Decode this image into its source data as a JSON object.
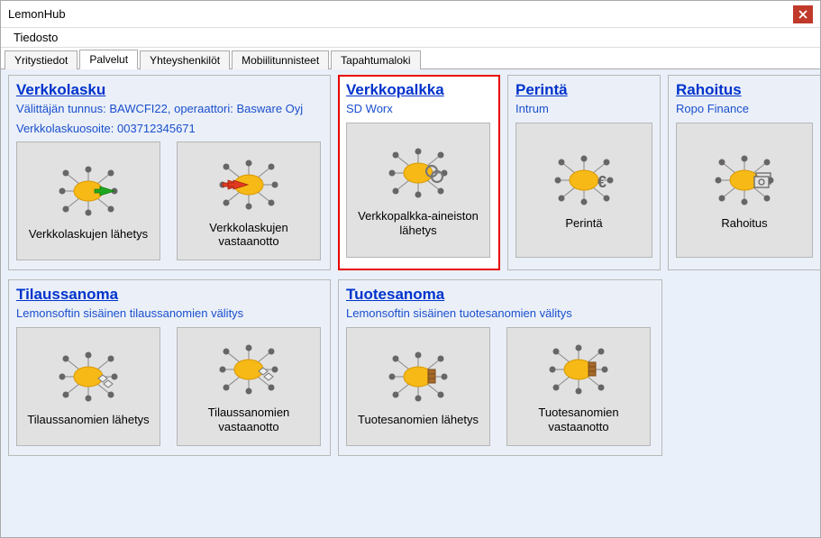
{
  "window": {
    "title": "LemonHub"
  },
  "menubar": {
    "file": "Tiedosto"
  },
  "tabs": [
    {
      "label": "Yritystiedot"
    },
    {
      "label": "Palvelut"
    },
    {
      "label": "Yhteyshenkilöt"
    },
    {
      "label": "Mobiilitunnisteet"
    },
    {
      "label": "Tapahtumaloki"
    }
  ],
  "activeTabIndex": 1,
  "panels": {
    "verkkolasku": {
      "title": "Verkkolasku",
      "sub1": "Välittäjän tunnus: BAWCFI22, operaattori: Basware Oyj",
      "sub2": "Verkkolaskuosoite: 003712345671",
      "tiles": [
        {
          "label": "Verkkolaskujen lähetys",
          "icon": "send"
        },
        {
          "label": "Verkkolaskujen vastaanotto",
          "icon": "receive"
        }
      ]
    },
    "verkkopalkka": {
      "title": "Verkkopalkka",
      "sub1": "SD Worx",
      "tiles": [
        {
          "label": "Verkkopalkka-aineiston lähetys",
          "icon": "link"
        }
      ]
    },
    "perinta": {
      "title": "Perintä",
      "sub1": "Intrum",
      "tiles": [
        {
          "label": "Perintä",
          "icon": "euro"
        }
      ]
    },
    "rahoitus": {
      "title": "Rahoitus",
      "sub1": "Ropo Finance",
      "tiles": [
        {
          "label": "Rahoitus",
          "icon": "folder"
        }
      ]
    },
    "tilaussanoma": {
      "title": "Tilaussanoma",
      "sub1": "Lemonsoftin sisäinen tilaussanomien välitys",
      "tiles": [
        {
          "label": "Tilaussanomien lähetys",
          "icon": "boxes-send"
        },
        {
          "label": "Tilaussanomien vastaanotto",
          "icon": "boxes-recv"
        }
      ]
    },
    "tuotesanoma": {
      "title": "Tuotesanoma",
      "sub1": "Lemonsoftin sisäinen tuotesanomien välitys",
      "tiles": [
        {
          "label": "Tuotesanomien lähetys",
          "icon": "stack-send"
        },
        {
          "label": "Tuotesanomien vastaanotto",
          "icon": "stack-recv"
        }
      ]
    }
  }
}
